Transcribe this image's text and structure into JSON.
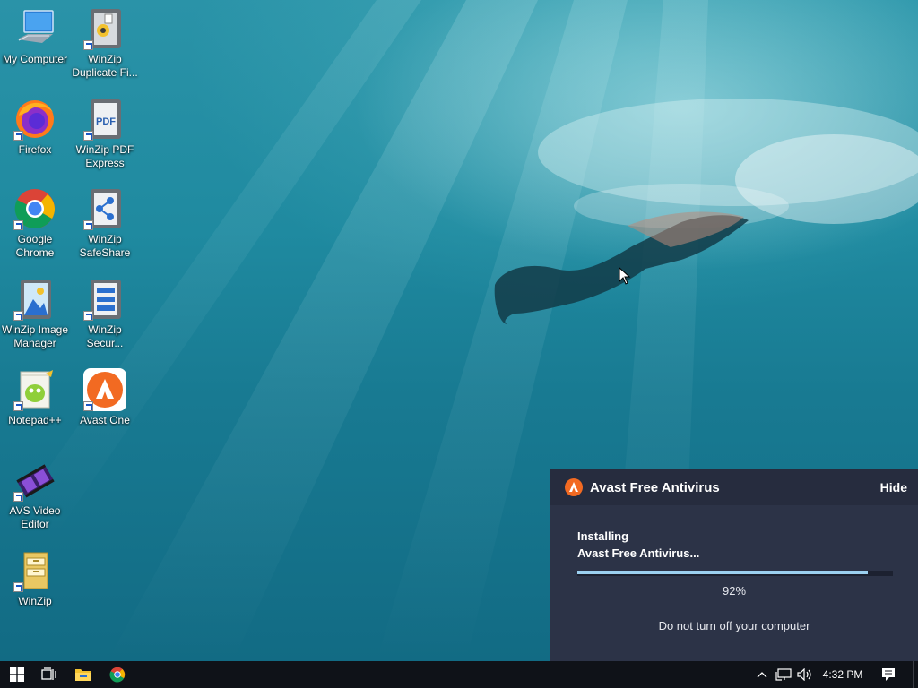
{
  "desktop": {
    "icons": [
      {
        "label": "My Computer"
      },
      {
        "label": "WinZip Duplicate Fi..."
      },
      {
        "label": "Firefox"
      },
      {
        "label": "WinZip PDF Express"
      },
      {
        "label": "Google Chrome"
      },
      {
        "label": "WinZip SafeShare"
      },
      {
        "label": "WinZip Image Manager"
      },
      {
        "label": "WinZip Secur..."
      },
      {
        "label": "Notepad++"
      },
      {
        "label": "Avast One"
      },
      {
        "label": "AVS Video Editor"
      },
      {
        "label": "WinZip"
      }
    ],
    "pdf_icon_text": "PDF"
  },
  "avast": {
    "title": "Avast Free Antivirus",
    "hide_label": "Hide",
    "status_line1": "Installing",
    "status_line2": "Avast Free Antivirus...",
    "progress_percent": 92,
    "progress_text": "92%",
    "note": "Do not turn off your computer",
    "brand_color": "#f26a22"
  },
  "taskbar": {
    "clock": "4:32 PM"
  }
}
